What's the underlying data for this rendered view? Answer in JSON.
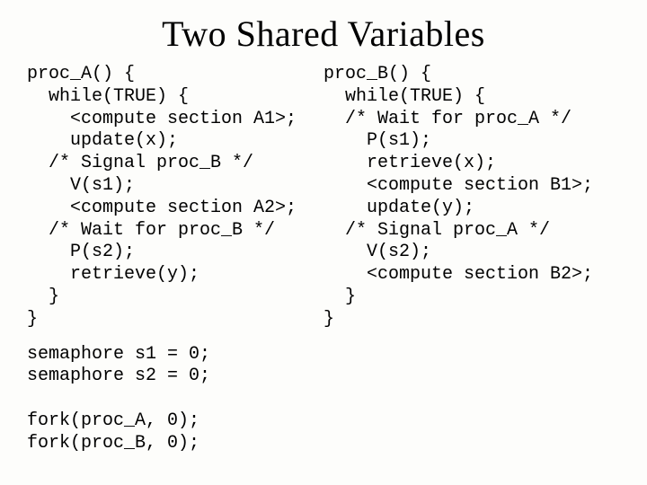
{
  "title": "Two Shared Variables",
  "left_code": "proc_A() {\n  while(TRUE) {\n    <compute section A1>;\n    update(x);\n  /* Signal proc_B */\n    V(s1);\n    <compute section A2>;\n  /* Wait for proc_B */\n    P(s2);\n    retrieve(y);\n  }\n}",
  "right_code": "proc_B() {\n  while(TRUE) {\n  /* Wait for proc_A */\n    P(s1);\n    retrieve(x);\n    <compute section B1>;\n    update(y);\n  /* Signal proc_A */\n    V(s2);\n    <compute section B2>;\n  }\n}",
  "footer_code": "semaphore s1 = 0;\nsemaphore s2 = 0;\n\nfork(proc_A, 0);\nfork(proc_B, 0);"
}
